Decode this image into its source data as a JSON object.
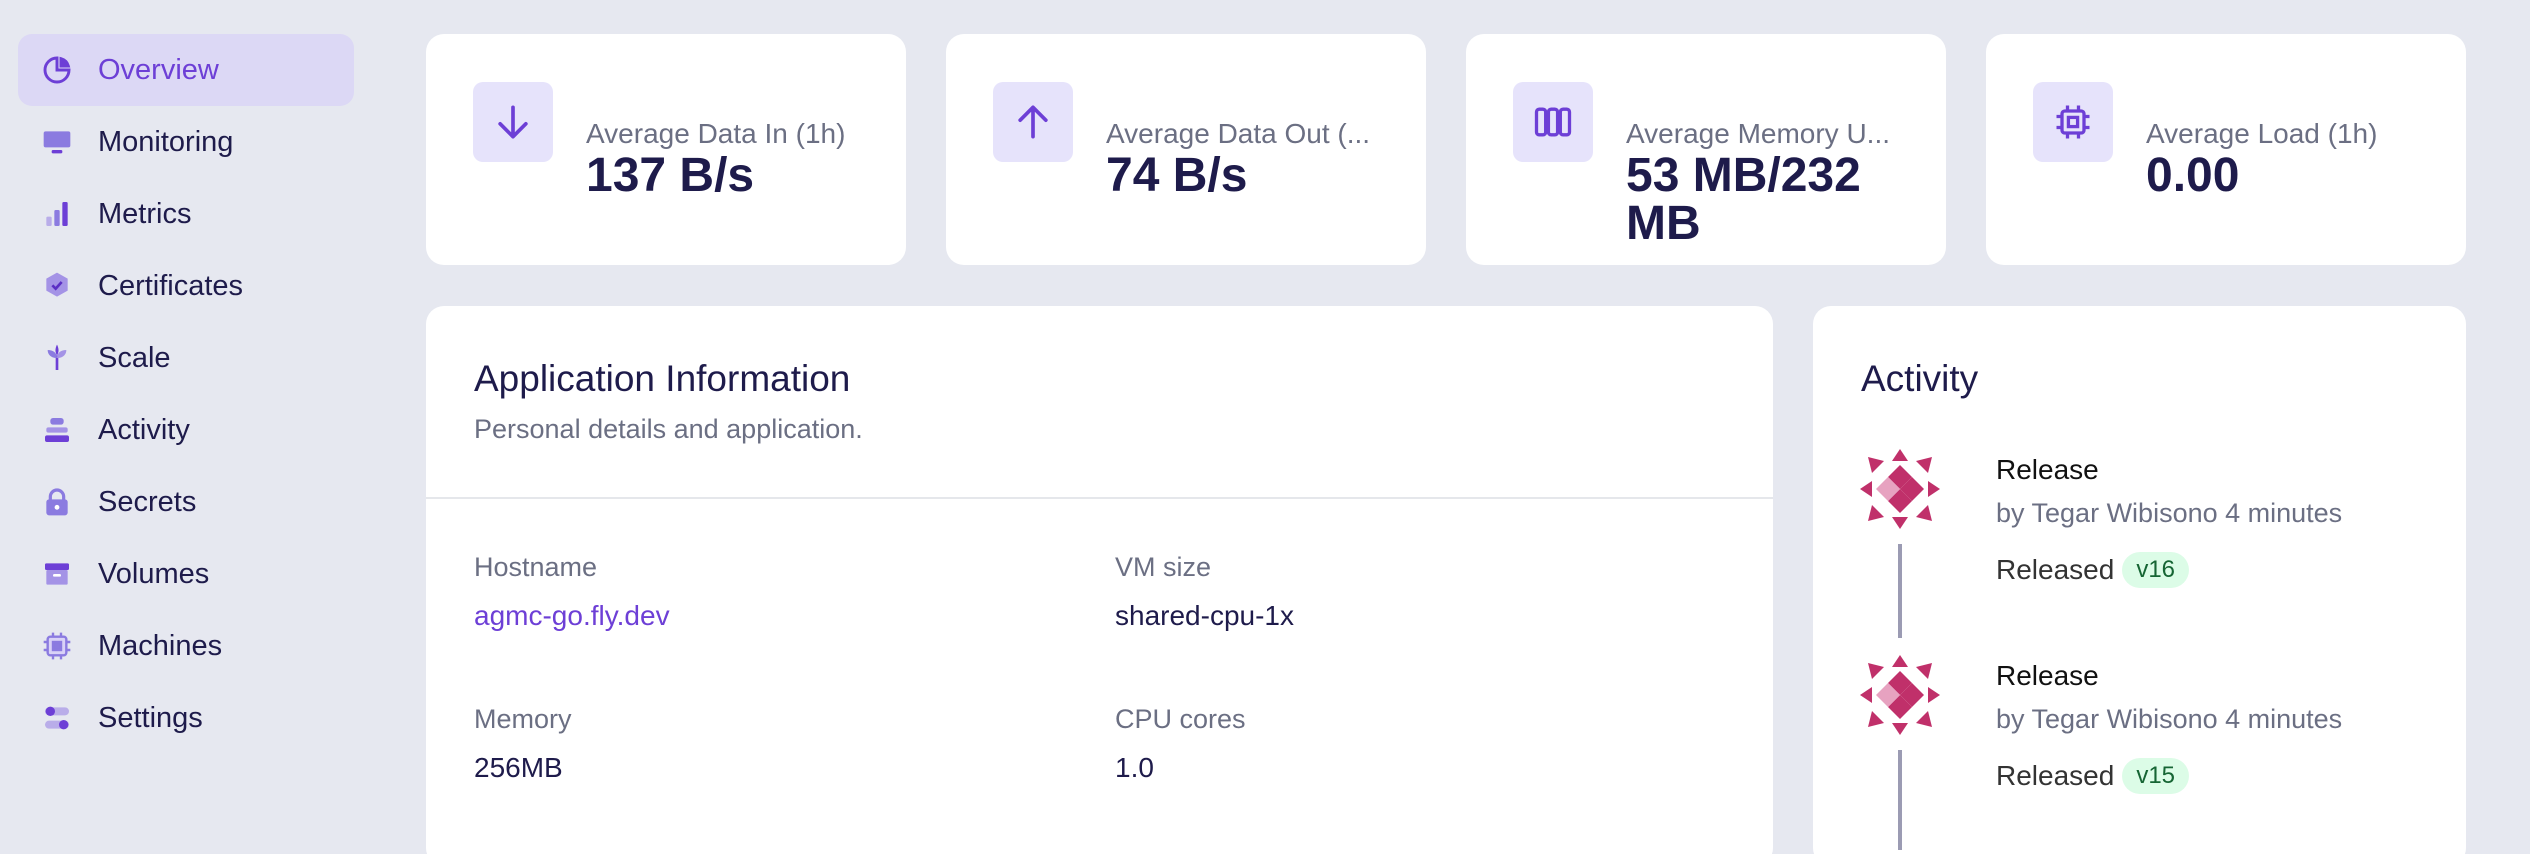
{
  "sidebar": {
    "items": [
      {
        "label": "Overview",
        "icon": "overview-icon",
        "active": true
      },
      {
        "label": "Monitoring",
        "icon": "monitor-icon"
      },
      {
        "label": "Metrics",
        "icon": "bar-chart-icon"
      },
      {
        "label": "Certificates",
        "icon": "badge-check-icon"
      },
      {
        "label": "Scale",
        "icon": "sprout-icon"
      },
      {
        "label": "Activity",
        "icon": "stack-icon"
      },
      {
        "label": "Secrets",
        "icon": "lock-icon"
      },
      {
        "label": "Volumes",
        "icon": "archive-box-icon"
      },
      {
        "label": "Machines",
        "icon": "chip-icon"
      },
      {
        "label": "Settings",
        "icon": "toggles-icon"
      }
    ]
  },
  "stats": [
    {
      "label": "Average Data In (1h)",
      "value": "137 B/s",
      "icon": "arrow-down-icon"
    },
    {
      "label": "Average Data Out (...",
      "value": "74 B/s",
      "icon": "arrow-up-icon"
    },
    {
      "label": "Average Memory U...",
      "value": "53 MB/232 MB",
      "icon": "columns-icon"
    },
    {
      "label": "Average Load (1h)",
      "value": "0.00",
      "icon": "cpu-icon"
    }
  ],
  "app_info": {
    "title": "Application Information",
    "subtitle": "Personal details and application.",
    "fields": [
      {
        "label": "Hostname",
        "value": "agmc-go.fly.dev"
      },
      {
        "label": "VM size",
        "value": "shared-cpu-1x"
      },
      {
        "label": "Memory",
        "value": "256MB"
      },
      {
        "label": "CPU cores",
        "value": "1.0"
      }
    ]
  },
  "activity": {
    "title": "Activity",
    "items": [
      {
        "type": "Release",
        "by": "by Tegar Wibisono 4 minutes",
        "status": "Released",
        "version": "v16"
      },
      {
        "type": "Release",
        "by": "by Tegar Wibisono 4 minutes",
        "status": "Released",
        "version": "v15"
      }
    ]
  },
  "colors": {
    "accent": "#6d3fd6",
    "background": "#e6e8f0",
    "active_bg": "#dcd8f5",
    "badge_bg": "#dcfce7",
    "avatar": "#c0306a"
  }
}
